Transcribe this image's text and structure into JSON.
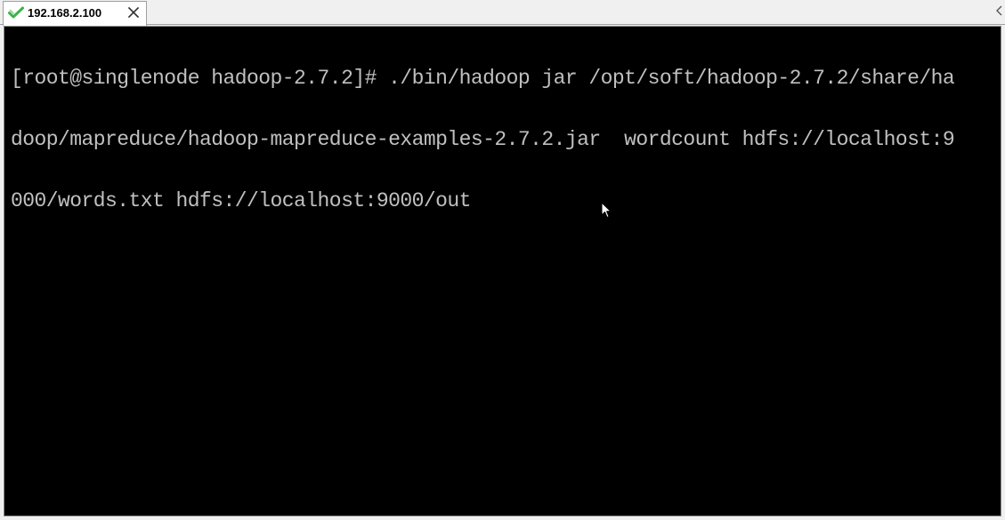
{
  "tab": {
    "title": "192.168.2.100",
    "status_icon": "green-check-icon",
    "close_icon": "close-icon",
    "check_color": "#3bb34a"
  },
  "tabbar": {
    "scroll_icon": "scroll-left-arrow-icon"
  },
  "terminal": {
    "background": "#000000",
    "foreground": "#c0c0c0",
    "lines": [
      "[root@singlenode hadoop-2.7.2]# ./bin/hadoop jar /opt/soft/hadoop-2.7.2/share/ha",
      "doop/mapreduce/hadoop-mapreduce-examples-2.7.2.jar  wordcount hdfs://localhost:9",
      "000/words.txt hdfs://localhost:9000/out"
    ]
  },
  "pointer": {
    "icon": "mouse-pointer-icon"
  }
}
